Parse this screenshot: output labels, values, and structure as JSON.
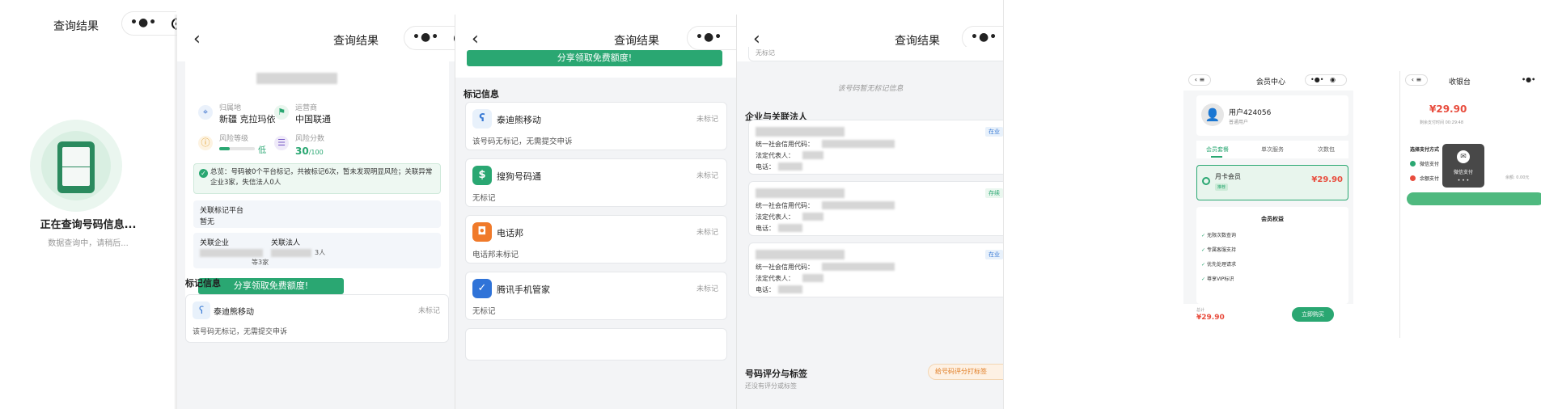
{
  "p1": {
    "title": "查询结果",
    "loading_title": "正在查询号码信息...",
    "loading_sub": "数据查询中，请稍后..."
  },
  "p2": {
    "title": "查询结果",
    "fields": [
      {
        "label": "归属地",
        "value": "新疆 克拉玛依",
        "icon": "location-icon"
      },
      {
        "label": "运营商",
        "value": "中国联通",
        "icon": "flag-icon"
      },
      {
        "label": "风险等级",
        "value": "低",
        "icon": "shield-icon"
      },
      {
        "label": "风险分数",
        "value": "30",
        "suffix": "/100",
        "icon": "list-icon"
      }
    ],
    "risk_level_fraction": 0.3,
    "summary": "总览：号码被0个平台标记，共被标记6次，暂未发现明显风险；关联异常企业3家，失信法人0人",
    "platform_label": "关联标记平台",
    "platform_value": "暂无",
    "company_label": "关联企业",
    "legal_label": "关联法人",
    "legal_count": "3人",
    "company_count": "等3家",
    "share_btn": "分享领取免费额度!",
    "section": "标记信息",
    "first_item": {
      "name": "泰迪熊移动",
      "status": "未标记",
      "desc": "该号码无标记，无需提交申诉"
    }
  },
  "p3": {
    "title": "查询结果",
    "share_btn": "分享领取免费额度!",
    "section": "标记信息",
    "items": [
      {
        "name": "泰迪熊移动",
        "status": "未标记",
        "desc": "该号码无标记，无需提交申诉",
        "icon": "bear-icon"
      },
      {
        "name": "搜狗号码通",
        "status": "未标记",
        "desc": "无标记",
        "icon": "sogou-icon"
      },
      {
        "name": "电话邦",
        "status": "未标记",
        "desc": "电话邦未标记",
        "icon": "dianhuabang-icon"
      },
      {
        "name": "腾讯手机管家",
        "status": "未标记",
        "desc": "无标记",
        "icon": "tencent-shield-icon"
      }
    ]
  },
  "p4": {
    "title": "查询结果",
    "top_cut": "无标记",
    "no_mark": "该号码暂无标记信息",
    "section": "企业与关联法人",
    "companies": [
      {
        "badge": "在业",
        "l1": "统一社会信用代码：",
        "l2": "法定代表人：",
        "l3": "电话："
      },
      {
        "badge": "存续",
        "l1": "统一社会信用代码：",
        "l2": "法定代表人：",
        "l3": "电话："
      },
      {
        "badge": "在业",
        "l1": "统一社会信用代码：",
        "l2": "法定代表人：",
        "l3": "电话："
      }
    ],
    "score_title": "号码评分与标签",
    "score_btn": "给号码评分打标签",
    "score_sub": "还没有评分或标签"
  },
  "p5": {
    "title": "会员中心",
    "user": "用户424056",
    "user_type": "普通用户",
    "tabs": [
      "会员套餐",
      "单次服务",
      "次数包"
    ],
    "plan_name": "月卡会员",
    "plan_tag": "推荐",
    "plan_price": "¥29.90",
    "benefits_title": "会员权益",
    "benefits": [
      "无限次数查询",
      "专属客服支持",
      "优先处理请求",
      "尊享VIP标识"
    ],
    "total_label": "总计",
    "total": "¥29.90",
    "buy_btn": "立即购买"
  },
  "p6": {
    "title": "收银台",
    "amount": "¥29.90",
    "countdown": "剩余支付时间 00:29:48",
    "method_title": "选择支付方式",
    "methods": [
      {
        "name": "微信支付"
      },
      {
        "name": "余额支付",
        "extra": "余额: 0.00元"
      }
    ],
    "toast": "微信支付"
  }
}
